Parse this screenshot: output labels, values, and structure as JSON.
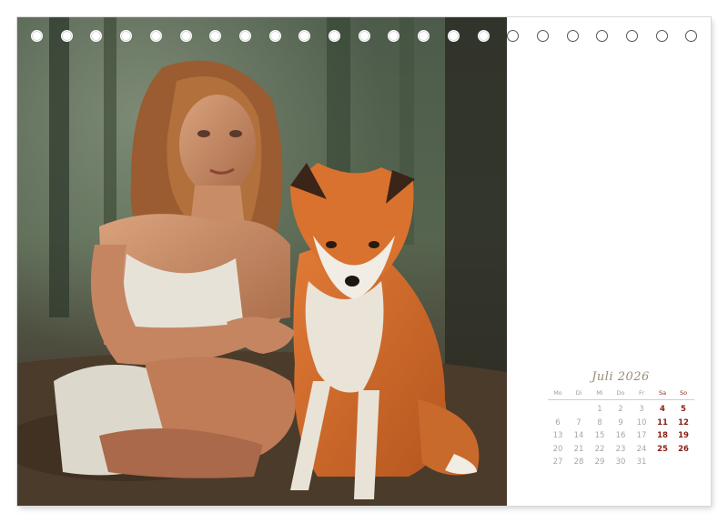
{
  "calendar": {
    "month_title": "Juli 2026",
    "weekdays": [
      "Mo",
      "Di",
      "Mi",
      "Do",
      "Fr",
      "Sa",
      "So"
    ],
    "weeks": [
      [
        "",
        "",
        "1",
        "2",
        "3",
        "4",
        "5"
      ],
      [
        "6",
        "7",
        "8",
        "9",
        "10",
        "11",
        "12"
      ],
      [
        "13",
        "14",
        "15",
        "16",
        "17",
        "18",
        "19"
      ],
      [
        "20",
        "21",
        "22",
        "23",
        "24",
        "25",
        "26"
      ],
      [
        "27",
        "28",
        "29",
        "30",
        "31",
        "",
        ""
      ]
    ]
  },
  "photo": {
    "subject": "woman crouching beside a red fox in a forest",
    "icon": "photo"
  },
  "binding": {
    "hole_count": 23
  },
  "colors": {
    "weekend": "#8a1c10",
    "weekday": "#a7a7a7",
    "title": "#9a8a76"
  }
}
